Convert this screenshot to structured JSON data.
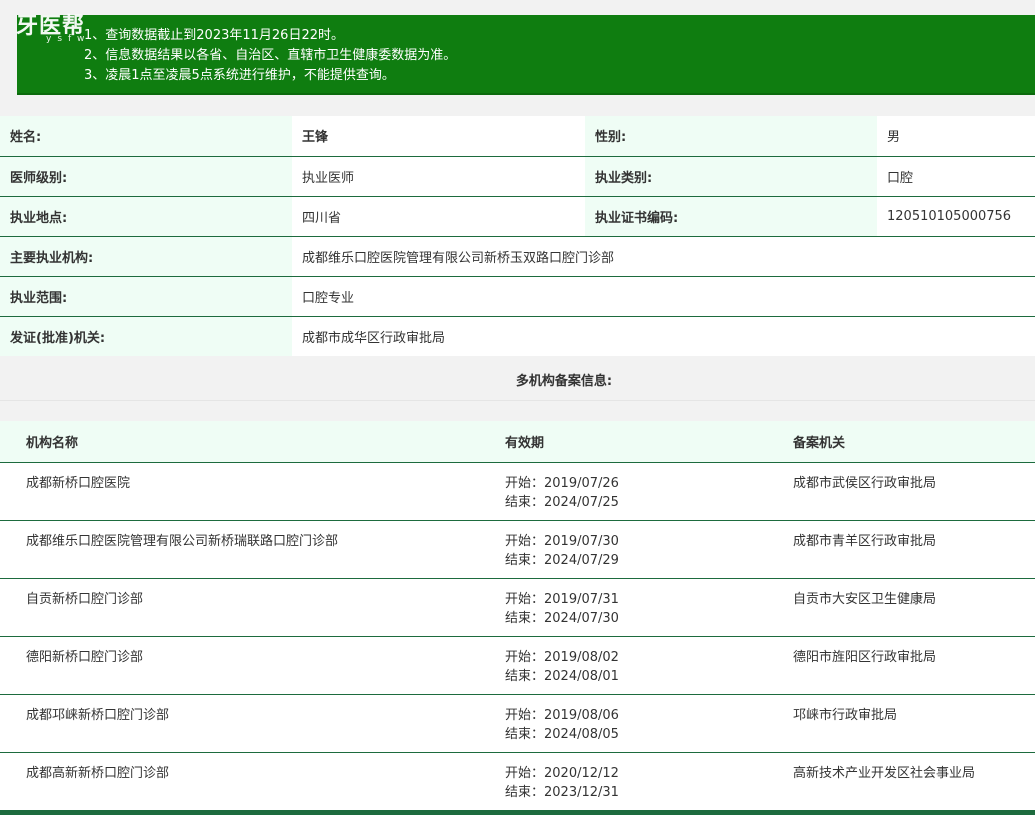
{
  "logo": {
    "mark": "牙医帮",
    "sub": "ysfw"
  },
  "notice": {
    "lines": [
      "1、查询数据截止到2023年11月26日22时。",
      "2、信息数据结果以各省、自治区、直辖市卫生健康委数据为准。",
      "3、凌晨1点至凌晨5点系统进行维护，不能提供查询。"
    ]
  },
  "info": {
    "name_label": "姓名:",
    "name_value": "王锋",
    "gender_label": "性别:",
    "gender_value": "男",
    "level_label": "医师级别:",
    "level_value": "执业医师",
    "category_label": "执业类别:",
    "category_value": "口腔",
    "location_label": "执业地点:",
    "location_value": "四川省",
    "cert_label": "执业证书编码:",
    "cert_value": "120510105000756",
    "org_label": "主要执业机构:",
    "org_value": "成都维乐口腔医院管理有限公司新桥玉双路口腔门诊部",
    "scope_label": "执业范围:",
    "scope_value": "口腔专业",
    "authority_label": "发证(批准)机关:",
    "authority_value": "成都市成华区行政审批局"
  },
  "multi": {
    "title": "多机构备案信息:",
    "headers": [
      "机构名称",
      "有效期",
      "备案机关"
    ],
    "rows": [
      {
        "name": "成都新桥口腔医院",
        "start": "开始：2019/07/26",
        "end": "结束：2024/07/25",
        "authority": "成都市武侯区行政审批局"
      },
      {
        "name": "成都维乐口腔医院管理有限公司新桥瑞联路口腔门诊部",
        "start": "开始：2019/07/30",
        "end": "结束：2024/07/29",
        "authority": "成都市青羊区行政审批局"
      },
      {
        "name": "自贡新桥口腔门诊部",
        "start": "开始：2019/07/31",
        "end": "结束：2024/07/30",
        "authority": "自贡市大安区卫生健康局"
      },
      {
        "name": "德阳新桥口腔门诊部",
        "start": "开始：2019/08/02",
        "end": "结束：2024/08/01",
        "authority": "德阳市旌阳区行政审批局"
      },
      {
        "name": "成都邛崃新桥口腔门诊部",
        "start": "开始：2019/08/06",
        "end": "结束：2024/08/05",
        "authority": "邛崃市行政审批局"
      },
      {
        "name": "成都高新新桥口腔门诊部",
        "start": "开始：2020/12/12",
        "end": "结束：2023/12/31",
        "authority": "高新技术产业开发区社会事业局"
      }
    ]
  }
}
